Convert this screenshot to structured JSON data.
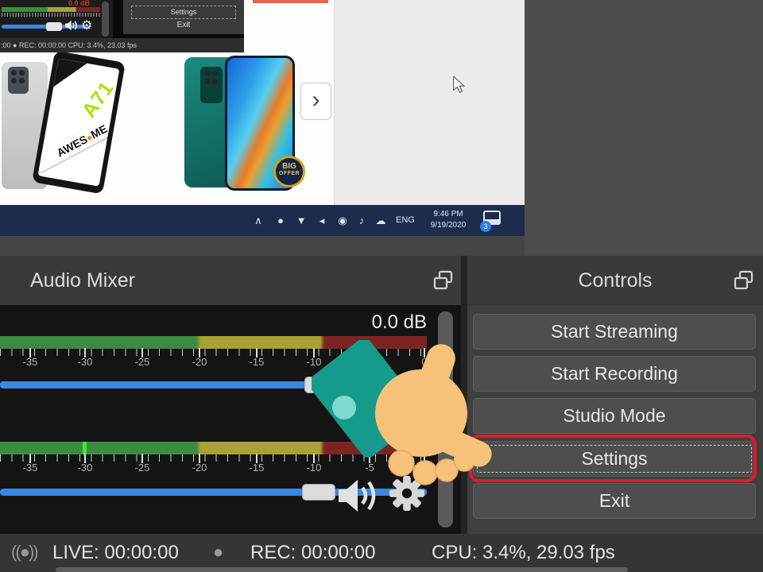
{
  "preview": {
    "mini_mixer": {
      "db_label": "0.0 dB"
    },
    "mini_controls": {
      "settings_label": "Settings",
      "exit_label": "Exit"
    },
    "mini_status_text": ":00 ●  REC: 00:00:00     CPU: 3.4%, 23.03 fps",
    "page": {
      "phone_a71_model": "A71",
      "ribbon_left": "AWES",
      "ribbon_dot": "●",
      "ribbon_right": "ME",
      "badge_line1": "BIG",
      "badge_line2": "OFFER",
      "next_arrow": "›"
    },
    "taskbar": {
      "tray": [
        "∧",
        "●",
        "▼",
        "◂",
        "◉",
        "♪",
        "☁"
      ],
      "language": "ENG",
      "time": "9:46 PM",
      "date": "9/19/2020",
      "notification_badge": "3"
    }
  },
  "audio_mixer": {
    "title": "Audio Mixer",
    "db_label": "0.0 dB",
    "ticks": [
      "-35",
      "-30",
      "-25",
      "-20",
      "-15",
      "-10",
      "-5",
      "0"
    ]
  },
  "controls": {
    "title": "Controls",
    "buttons": [
      "Start Streaming",
      "Start Recording",
      "Studio Mode",
      "Settings",
      "Exit"
    ]
  },
  "status_bar": {
    "live": "LIVE: 00:00:00",
    "rec": "REC: 00:00:00",
    "cpu": "CPU: 3.4%, 29.03 fps"
  },
  "icons": {
    "gear": "⚙"
  },
  "colors": {
    "annotation_red": "#e2182e",
    "slider_blue": "#3b87e0",
    "meter_green": "#3d8b40",
    "meter_yellow": "#a6a235",
    "meter_red": "#7e2323",
    "hand_skin": "#f6c279",
    "sleeve_teal": "#169a8b",
    "taskbar_navy": "#1d2c4d"
  }
}
